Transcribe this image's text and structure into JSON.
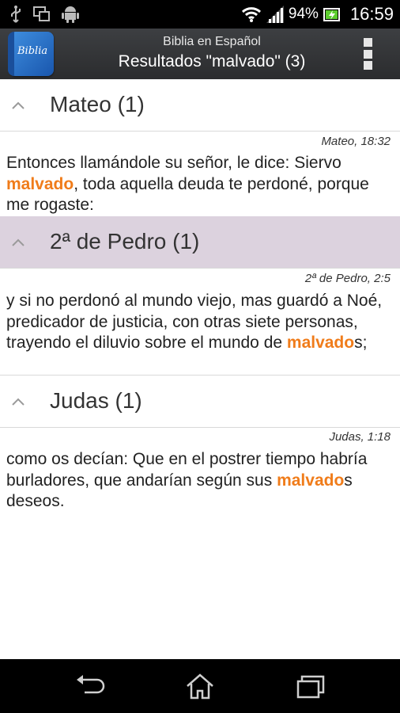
{
  "status_bar": {
    "icons": [
      "usb-icon",
      "screen-mirror-icon",
      "android-icon",
      "wifi-icon",
      "signal-icon",
      "battery-icon"
    ],
    "battery": "94%",
    "time": "16:59"
  },
  "action_bar": {
    "app_icon_label": "Biblia",
    "subtitle": "Biblia en Español",
    "title": "Resultados \"malvado\"  (3)"
  },
  "results": [
    {
      "group": "Mateo (1)",
      "selected": false,
      "reference": "Mateo, 18:32",
      "text_parts": [
        "Entonces llamándole su señor, le dice: Siervo ",
        "malvado",
        ", toda aquella deuda te perdoné, porque me rogaste:"
      ]
    },
    {
      "group": "2ª de Pedro (1)",
      "selected": true,
      "reference": "2ª de Pedro, 2:5",
      "text_parts": [
        "y si no perdonó al mundo viejo, mas guardó a Noé, predicador de justicia, con otras siete personas, trayendo el diluvio sobre el mundo de ",
        "malvado",
        "s;"
      ]
    },
    {
      "group": "Judas (1)",
      "selected": false,
      "reference": "Judas, 1:18",
      "text_parts": [
        "como os decían: Que en el postrer tiempo habría burladores, que andarían según sus ",
        "malvado",
        "s deseos."
      ]
    }
  ],
  "colors": {
    "highlight": "#f07c1a",
    "selected_group": "#dcd2de",
    "action_bar": "#333537"
  },
  "nav_bar": {
    "icons": [
      "back-icon",
      "home-icon",
      "recent-apps-icon"
    ]
  }
}
